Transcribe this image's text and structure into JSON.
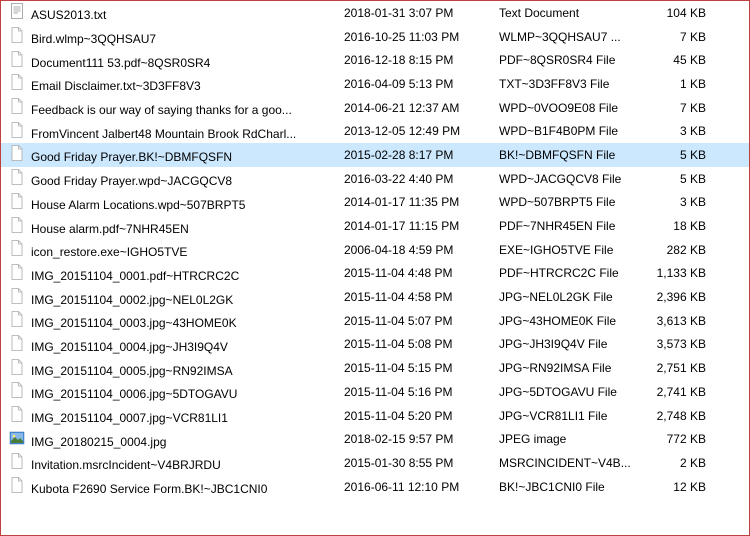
{
  "files": [
    {
      "name": "ASUS2013.txt",
      "date": "2018-01-31 3:07 PM",
      "type": "Text Document",
      "size": "104 KB",
      "icon": "text",
      "selected": false
    },
    {
      "name": "Bird.wlmp~3QQHSAU7",
      "date": "2016-10-25 11:03 PM",
      "type": "WLMP~3QQHSAU7 ...",
      "size": "7 KB",
      "icon": "file",
      "selected": false
    },
    {
      "name": "Document111 53.pdf~8QSR0SR4",
      "date": "2016-12-18 8:15 PM",
      "type": "PDF~8QSR0SR4 File",
      "size": "45 KB",
      "icon": "file",
      "selected": false
    },
    {
      "name": "Email Disclaimer.txt~3D3FF8V3",
      "date": "2016-04-09 5:13 PM",
      "type": "TXT~3D3FF8V3 File",
      "size": "1 KB",
      "icon": "file",
      "selected": false
    },
    {
      "name": "Feedback is our way of saying thanks for a goo...",
      "date": "2014-06-21 12:37 AM",
      "type": "WPD~0VOO9E08 File",
      "size": "7 KB",
      "icon": "file",
      "selected": false
    },
    {
      "name": "FromVincent Jalbert48 Mountain Brook RdCharl...",
      "date": "2013-12-05 12:49 PM",
      "type": "WPD~B1F4B0PM File",
      "size": "3 KB",
      "icon": "file",
      "selected": false
    },
    {
      "name": "Good Friday Prayer.BK!~DBMFQSFN",
      "date": "2015-02-28 8:17 PM",
      "type": "BK!~DBMFQSFN File",
      "size": "5 KB",
      "icon": "file",
      "selected": true
    },
    {
      "name": "Good Friday Prayer.wpd~JACGQCV8",
      "date": "2016-03-22 4:40 PM",
      "type": "WPD~JACGQCV8 File",
      "size": "5 KB",
      "icon": "file",
      "selected": false
    },
    {
      "name": "House Alarm Locations.wpd~507BRPT5",
      "date": "2014-01-17 11:35 PM",
      "type": "WPD~507BRPT5 File",
      "size": "3 KB",
      "icon": "file",
      "selected": false
    },
    {
      "name": "House alarm.pdf~7NHR45EN",
      "date": "2014-01-17 11:15 PM",
      "type": "PDF~7NHR45EN File",
      "size": "18 KB",
      "icon": "file",
      "selected": false
    },
    {
      "name": "icon_restore.exe~IGHO5TVE",
      "date": "2006-04-18 4:59 PM",
      "type": "EXE~IGHO5TVE File",
      "size": "282 KB",
      "icon": "file",
      "selected": false
    },
    {
      "name": "IMG_20151104_0001.pdf~HTRCRC2C",
      "date": "2015-11-04 4:48 PM",
      "type": "PDF~HTRCRC2C File",
      "size": "1,133 KB",
      "icon": "file",
      "selected": false
    },
    {
      "name": "IMG_20151104_0002.jpg~NEL0L2GK",
      "date": "2015-11-04 4:58 PM",
      "type": "JPG~NEL0L2GK File",
      "size": "2,396 KB",
      "icon": "file",
      "selected": false
    },
    {
      "name": "IMG_20151104_0003.jpg~43HOME0K",
      "date": "2015-11-04 5:07 PM",
      "type": "JPG~43HOME0K File",
      "size": "3,613 KB",
      "icon": "file",
      "selected": false
    },
    {
      "name": "IMG_20151104_0004.jpg~JH3I9Q4V",
      "date": "2015-11-04 5:08 PM",
      "type": "JPG~JH3I9Q4V File",
      "size": "3,573 KB",
      "icon": "file",
      "selected": false
    },
    {
      "name": "IMG_20151104_0005.jpg~RN92IMSA",
      "date": "2015-11-04 5:15 PM",
      "type": "JPG~RN92IMSA File",
      "size": "2,751 KB",
      "icon": "file",
      "selected": false
    },
    {
      "name": "IMG_20151104_0006.jpg~5DTOGAVU",
      "date": "2015-11-04 5:16 PM",
      "type": "JPG~5DTOGAVU File",
      "size": "2,741 KB",
      "icon": "file",
      "selected": false
    },
    {
      "name": "IMG_20151104_0007.jpg~VCR81LI1",
      "date": "2015-11-04 5:20 PM",
      "type": "JPG~VCR81LI1 File",
      "size": "2,748 KB",
      "icon": "file",
      "selected": false
    },
    {
      "name": "IMG_20180215_0004.jpg",
      "date": "2018-02-15 9:57 PM",
      "type": "JPEG image",
      "size": "772 KB",
      "icon": "jpeg",
      "selected": false
    },
    {
      "name": "Invitation.msrcIncident~V4BRJRDU",
      "date": "2015-01-30 8:55 PM",
      "type": "MSRCINCIDENT~V4B...",
      "size": "2 KB",
      "icon": "file",
      "selected": false
    },
    {
      "name": "Kubota F2690 Service Form.BK!~JBC1CNI0",
      "date": "2016-06-11 12:10 PM",
      "type": "BK!~JBC1CNI0 File",
      "size": "12 KB",
      "icon": "file",
      "selected": false
    }
  ]
}
